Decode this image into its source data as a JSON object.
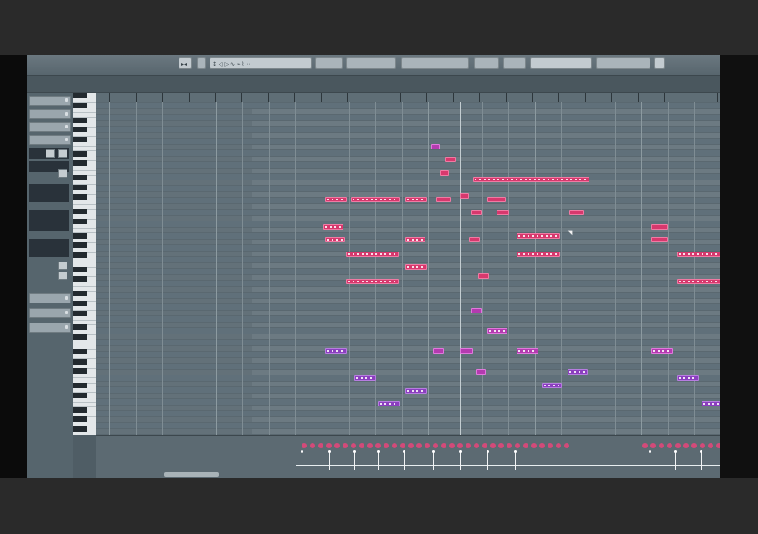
{
  "toolbar": {
    "items": [
      "▸◂",
      "",
      "↕ ◁ ▷ ∿ ⌁ ⌇ ⋯",
      "",
      "",
      "",
      "",
      "",
      "",
      ""
    ]
  },
  "inspector": {
    "labels": [
      "",
      "",
      "",
      ""
    ]
  },
  "colors": {
    "note_red": "#d7386d",
    "note_purple": "#8b3fbf",
    "background": "#6c7a82"
  },
  "icons": [
    "mouse-pointer-icon"
  ]
}
